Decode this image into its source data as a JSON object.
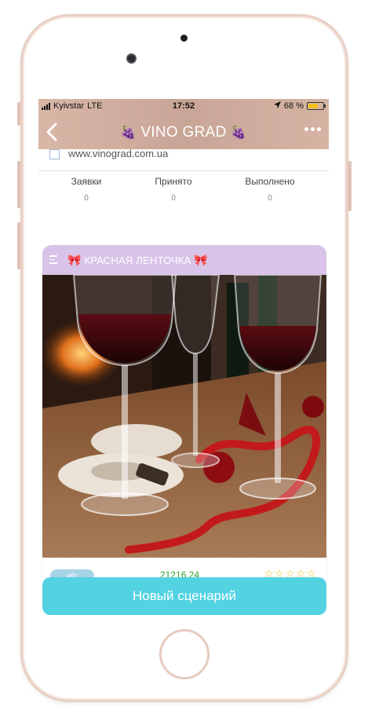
{
  "status_bar": {
    "carrier": "Kyivstar",
    "network": "LTE",
    "time": "17:52",
    "battery_percent": "68 %",
    "battery_level": 0.68,
    "icons": [
      "signal-bars-icon",
      "location-arrow-icon",
      "battery-icon"
    ]
  },
  "header": {
    "title": "VINO GRAD",
    "title_emoji": "🍇",
    "back_icon": "chevron-left-icon",
    "more_icon": "ellipsis-icon"
  },
  "contact": {
    "website": "www.vinograd.com.ua"
  },
  "stats": [
    {
      "label": "Заявки",
      "count": "0"
    },
    {
      "label": "Принято",
      "count": "0"
    },
    {
      "label": "Выполнено",
      "count": "0"
    }
  ],
  "scenario_card": {
    "title": "КРАСНАЯ ЛЕНТОЧКА",
    "title_emoji": "🎀",
    "image_description_icon": "wine-glasses-photo",
    "tag": "абс",
    "date": "21216.24",
    "stars": "☆☆☆☆☆",
    "header_color": "#d9c3e8"
  },
  "actions": {
    "new_scenario_label": "Новый сценарий",
    "button_color": "#53d2e2"
  }
}
